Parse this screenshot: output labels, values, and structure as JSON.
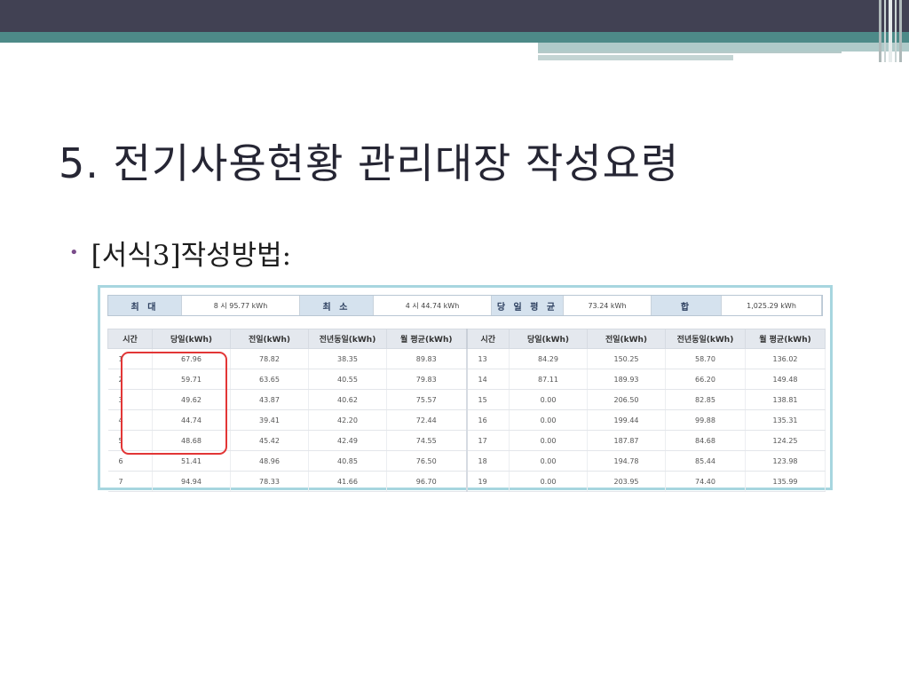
{
  "slide": {
    "title": "5. 전기사용현황 관리대장 작성요령",
    "bullet": "[서식3]작성방법:"
  },
  "summary": [
    {
      "label": "최 대",
      "value": "8 시 95.77 kWh"
    },
    {
      "label": "최 소",
      "value": "4 시 44.74 kWh"
    },
    {
      "label": "당 일 평 균",
      "value": "73.24 kWh"
    },
    {
      "label": "합",
      "value": "1,025.29 kWh"
    }
  ],
  "table": {
    "headers": [
      "시간",
      "당일(kWh)",
      "전일(kWh)",
      "전년동일(kWh)",
      "월 평균(kWh)",
      "시간",
      "당일(kWh)",
      "전일(kWh)",
      "전년동일(kWh)",
      "월 평균(kWh)"
    ],
    "rows": [
      [
        "1",
        "67.96",
        "78.82",
        "38.35",
        "89.83",
        "13",
        "84.29",
        "150.25",
        "58.70",
        "136.02"
      ],
      [
        "2",
        "59.71",
        "63.65",
        "40.55",
        "79.83",
        "14",
        "87.11",
        "189.93",
        "66.20",
        "149.48"
      ],
      [
        "3",
        "49.62",
        "43.87",
        "40.62",
        "75.57",
        "15",
        "0.00",
        "206.50",
        "82.85",
        "138.81"
      ],
      [
        "4",
        "44.74",
        "39.41",
        "42.20",
        "72.44",
        "16",
        "0.00",
        "199.44",
        "99.88",
        "135.31"
      ],
      [
        "5",
        "48.68",
        "45.42",
        "42.49",
        "74.55",
        "17",
        "0.00",
        "187.87",
        "84.68",
        "124.25"
      ],
      [
        "6",
        "51.41",
        "48.96",
        "40.85",
        "76.50",
        "18",
        "0.00",
        "194.78",
        "85.44",
        "123.98"
      ],
      [
        "7",
        "94.94",
        "78.33",
        "41.66",
        "96.70",
        "19",
        "0.00",
        "203.95",
        "74.40",
        "135.99"
      ]
    ]
  },
  "colors": {
    "header_band": "#414153",
    "accent_teal": "#4d8a88",
    "highlight_red": "#e23636",
    "panel_border": "#a7d6df"
  }
}
